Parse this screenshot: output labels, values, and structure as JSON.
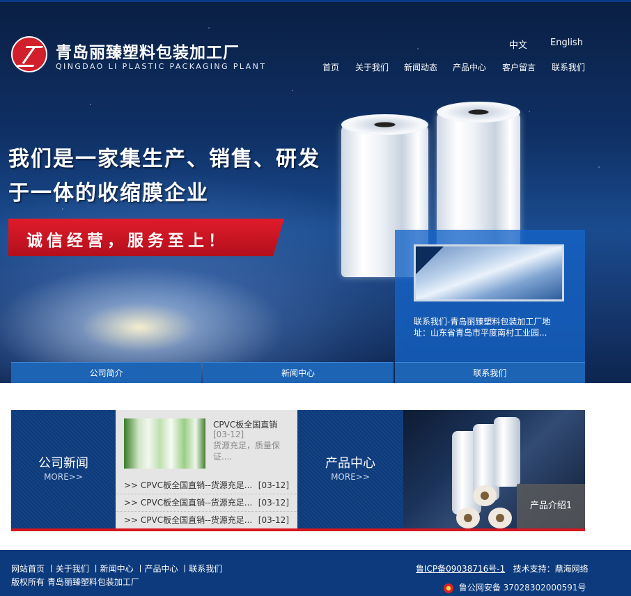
{
  "brand": {
    "name_cn": "青岛丽臻塑料包装加工厂",
    "name_en": "QINGDAO LI PLASTIC PACKAGING PLANT"
  },
  "lang": {
    "cn": "中文",
    "en": "English"
  },
  "nav": [
    "首页",
    "关于我们",
    "新闻动态",
    "产品中心",
    "客户留言",
    "联系我们"
  ],
  "hero": {
    "slogan_1": "我们是一家集生产、销售、研发",
    "slogan_2": "于一体的收缩膜企业",
    "motto": "诚信经营，服务至上！"
  },
  "contact_panel": {
    "text": "联系我们-青岛丽臻塑料包装加工厂地址：山东省青岛市平度南村工业园..."
  },
  "tabs": [
    "公司简介",
    "新闻中心",
    "联系我们"
  ],
  "company_news": {
    "title": "公司新闻",
    "more": "MORE>>"
  },
  "news": {
    "featured": {
      "title": "CPVC板全国直销",
      "date": "[03-12]",
      "summary": "货源充足，质量保证...."
    },
    "items": [
      {
        "text": ">>   CPVC板全国直销--货源充足...",
        "date": "[03-12]"
      },
      {
        "text": ">>   CPVC板全国直销--货源充足...",
        "date": "[03-12]"
      },
      {
        "text": ">>   CPVC板全国直销--货源充足...",
        "date": "[03-12]"
      }
    ]
  },
  "product_center": {
    "title": "产品中心",
    "more": "MORE>>",
    "intro_label": "产品介绍1"
  },
  "footer": {
    "links": "网站首页 丨关于我们 丨新闻中心 丨产品中心 丨联系我们",
    "copyright": "版权所有 青岛丽臻塑料包装加工厂",
    "icp": "鲁ICP备09038716号-1",
    "tech_support": "技术支持：鼎海网络",
    "police": "鲁公网安备 37028302000591号"
  },
  "colors": {
    "primary": "#0c3a7c",
    "accent": "#d7161f",
    "tab": "#1d64b5"
  }
}
